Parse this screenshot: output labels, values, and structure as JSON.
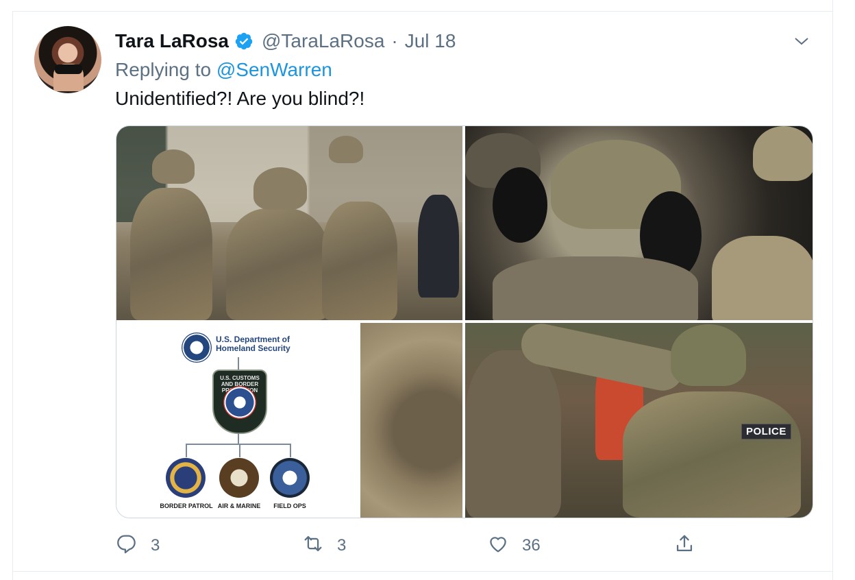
{
  "tweet": {
    "author_name": "Tara LaRosa",
    "verified": true,
    "handle": "@TaraLaRosa",
    "separator": "·",
    "date": "Jul 18",
    "replying_prefix": "Replying to",
    "replying_to": "@SenWarren",
    "text": "Unidentified?! Are you blind?!"
  },
  "media": {
    "dhs_title": "U.S. Department of Homeland Security",
    "cbp_badge_text": "U.S. CUSTOMS AND BORDER PROTECTION",
    "components": [
      "BORDER PATROL",
      "AIR & MARINE",
      "FIELD OPS"
    ],
    "police_patch": "POLICE"
  },
  "actions": {
    "reply_count": "3",
    "retweet_count": "3",
    "like_count": "36"
  },
  "icons": {
    "verified": "verified-badge-icon",
    "caret": "chevron-down-icon",
    "reply": "reply-icon",
    "retweet": "retweet-icon",
    "like": "heart-icon",
    "share": "share-icon"
  },
  "colors": {
    "accent": "#1b95e0",
    "secondary_text": "#5b7083",
    "primary_text": "#0f1419",
    "border": "#e6ecf0"
  }
}
